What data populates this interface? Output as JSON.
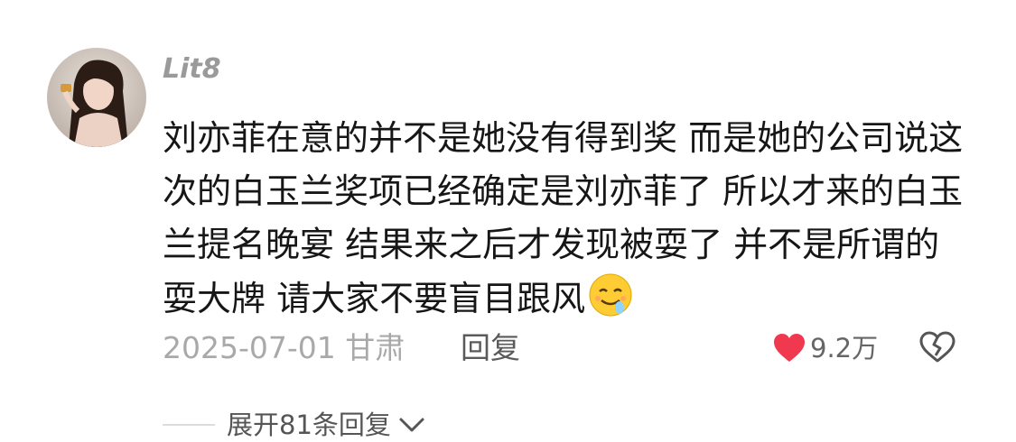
{
  "comment": {
    "username": "Lit8",
    "avatar_icon": "avatar-photo",
    "text": "刘亦菲在意的并不是她没有得到奖  而是她的公司说这次的白玉兰奖项已经确定是刘亦菲了  所以才来的白玉兰提名晚宴  结果来之后才发现被耍了  并不是所谓的耍大牌 请大家不要盲目跟风",
    "emoji": "drooling-face-emoji",
    "date": "2025-07-01",
    "location": "甘肃",
    "reply_label": "回复",
    "likes": "9.2万",
    "like_icon": "heart-icon",
    "like_color": "#f0394f",
    "dislike_icon": "broken-heart-icon"
  },
  "replies": {
    "expand_label": "展开81条回复",
    "chevron_icon": "chevron-down-icon"
  }
}
